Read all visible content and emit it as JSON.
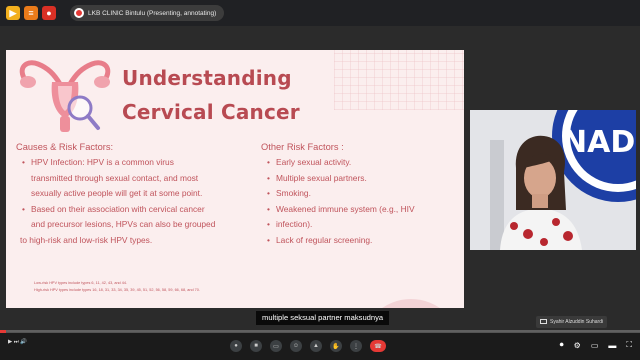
{
  "window": {
    "title": "LKB CLINIC Bintulu (Presenting, annotating)"
  },
  "slide": {
    "title_line1": "Understanding",
    "title_line2": "Cervical Cancer",
    "left": {
      "heading": "Causes & Risk Factors:",
      "bullets": [
        "HPV Infection: HPV is a common virus",
        "transmitted through sexual contact, and most",
        "sexually active people will get it at some point.",
        "Based on their association with cervical cancer",
        "and precursor lesions, HPVs can also be grouped",
        "to high-risk and low-risk HPV types."
      ]
    },
    "right": {
      "heading": "Other Risk Factors :",
      "bullets": [
        "Early sexual activity.",
        "Multiple sexual partners.",
        "Smoking.",
        "Weakened immune system (e.g., HIV",
        "infection).",
        "Lack of regular screening."
      ]
    },
    "footnote1": "Low-risk HPV types include types 6, 11, 42, 43, and 44.",
    "footnote2": "High-risk HPV types include types 16, 18, 31, 33, 34, 35, 39, 45, 51, 52, 56, 58, 59, 66, 68, and 70."
  },
  "video": {
    "logo_text": "NAD"
  },
  "caption": "multiple seksual partner maksudnya",
  "presenter": {
    "name": "Syahir Alzuddin Suhardi"
  },
  "player": {
    "progress": 0.01
  },
  "colors": {
    "accent": "#b84a52",
    "text": "#c0545c",
    "slide_bg": "#fbeeee",
    "progress": "#e53935"
  },
  "icons": [
    "app-icon",
    "mic-icon",
    "camera-icon",
    "hand-icon",
    "end-call-icon",
    "settings-icon",
    "fullscreen-icon"
  ]
}
